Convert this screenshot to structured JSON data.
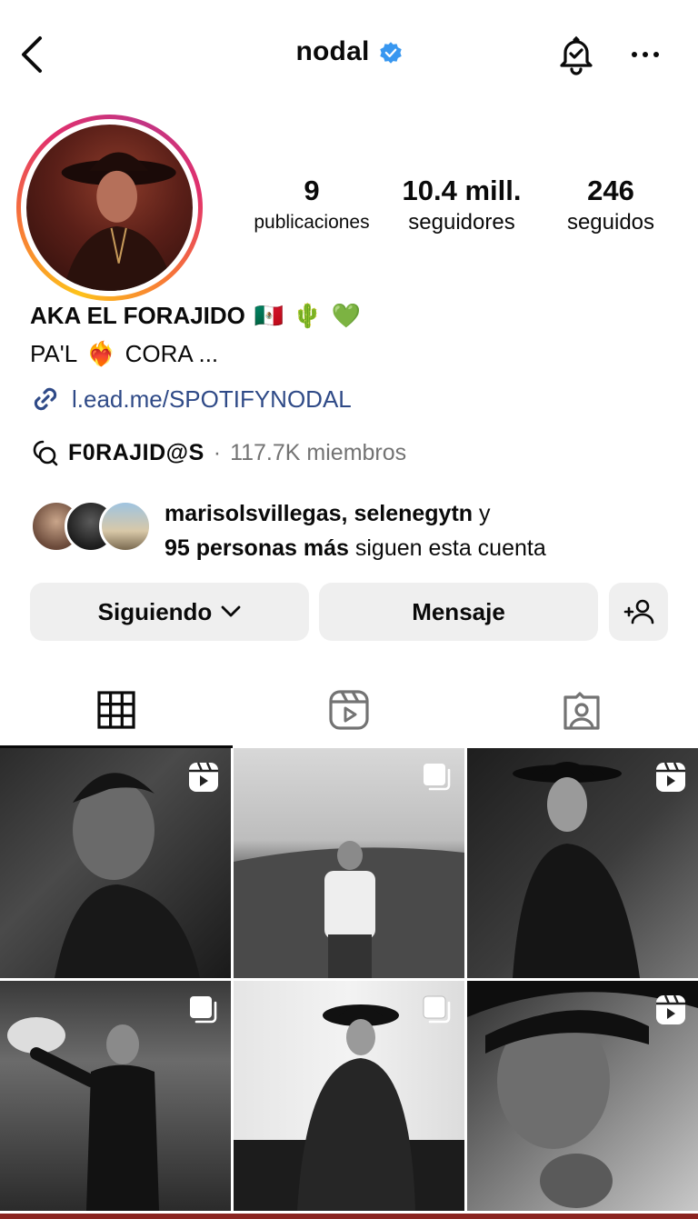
{
  "header": {
    "username": "nodal",
    "verified_color": "#3897f0"
  },
  "icons": {
    "back": "chevron-left-icon",
    "verified": "verified-badge-icon",
    "bell": "bell-check-icon",
    "more": "more-horizontal-icon",
    "link": "link-icon",
    "community": "chat-bubbles-icon",
    "chevron": "chevron-down-icon",
    "add_person": "add-person-icon",
    "grid": "grid-icon",
    "reels": "reels-icon",
    "tagged": "tagged-icon",
    "reel_badge": "reel-badge-icon",
    "carousel_badge": "carousel-badge-icon"
  },
  "stats": {
    "posts": {
      "value": "9",
      "label": "publicaciones"
    },
    "followers": {
      "value": "10.4 mill.",
      "label": "seguidores"
    },
    "following": {
      "value": "246",
      "label": "seguidos"
    }
  },
  "bio": {
    "name": "AKA EL FORAJIDO",
    "name_emojis": [
      "🇲🇽",
      "🌵",
      "💚"
    ],
    "line1_start": "PA'L",
    "line1_emoji": "❤️‍🔥",
    "line1_end": "CORA ...",
    "link": "l.ead.me/SPOTIFYNODAL",
    "link_color": "#2f4a87"
  },
  "community": {
    "name": "F0RAJID@S",
    "separator": "·",
    "members": "117.7K miembros"
  },
  "mutuals": {
    "names": "marisolsvillegas, selenegytn",
    "conj": "y",
    "others": "95 personas más",
    "suffix": "siguen esta cuenta"
  },
  "buttons": {
    "following": "Siguiendo",
    "message": "Mensaje"
  },
  "grid": [
    {
      "badge": "reel"
    },
    {
      "badge": "carousel"
    },
    {
      "badge": "reel"
    },
    {
      "badge": "carousel"
    },
    {
      "badge": "carousel"
    },
    {
      "badge": "reel"
    }
  ]
}
